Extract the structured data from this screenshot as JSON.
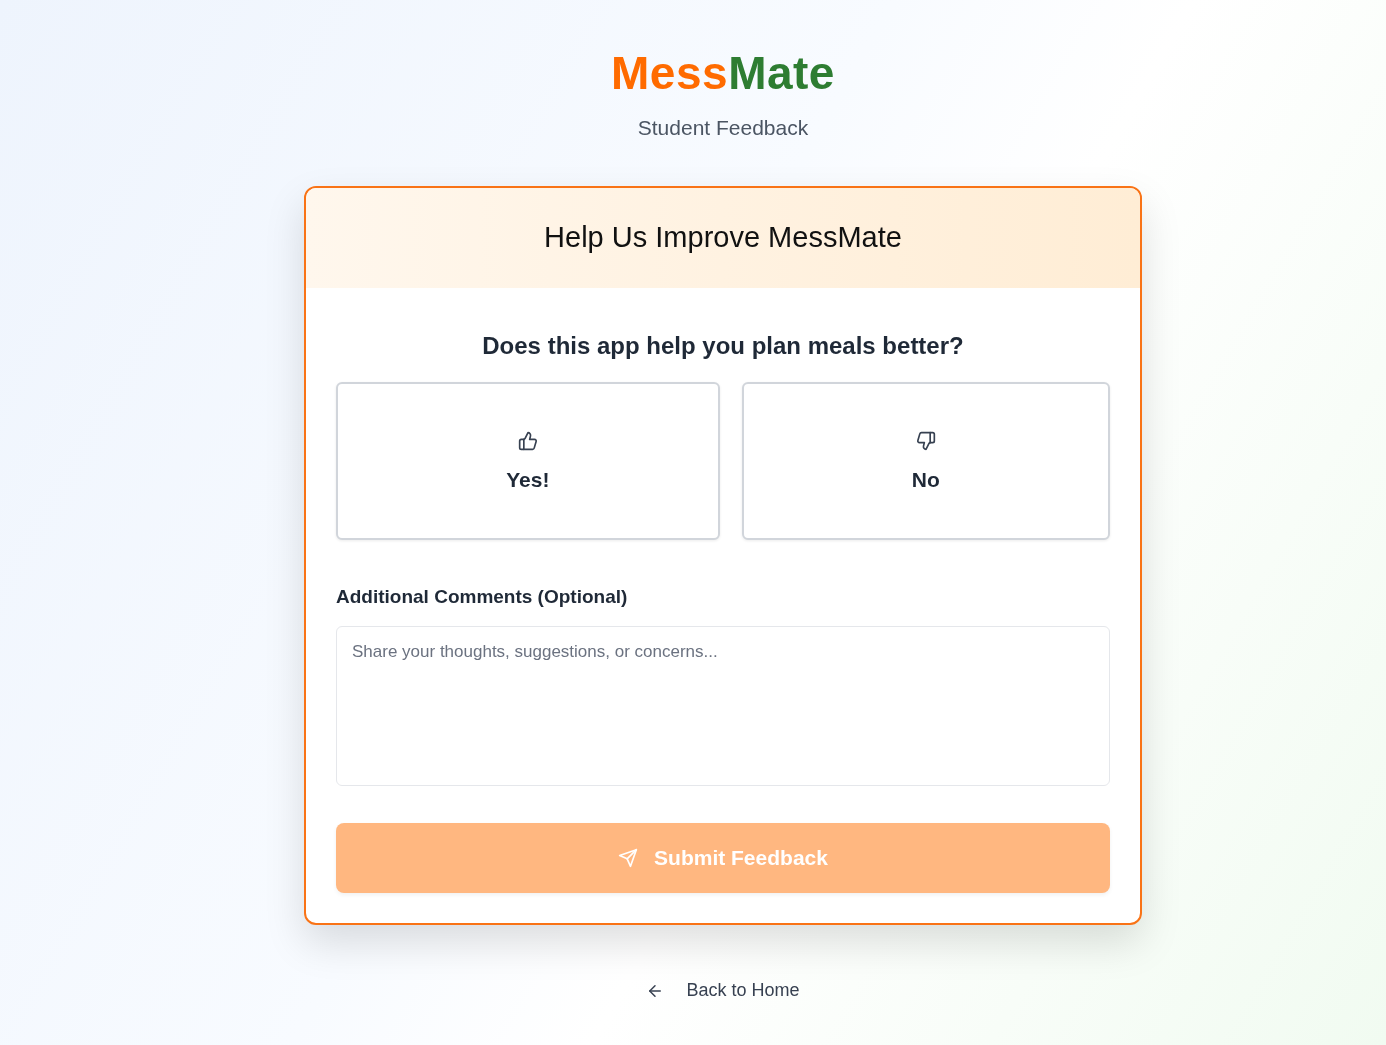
{
  "brand": {
    "parts": [
      {
        "text": "Mess",
        "color": "#ff6b00"
      },
      {
        "text": "Mate",
        "color": "#2e7d32"
      }
    ]
  },
  "subtitle": "Student Feedback",
  "card": {
    "title": "Help Us Improve MessMate",
    "question": "Does this app help you plan meals better?",
    "options": [
      {
        "kind": "thumbs-up",
        "label": "Yes!",
        "selected": false
      },
      {
        "kind": "thumbs-down",
        "label": "No",
        "selected": false
      }
    ],
    "comments": {
      "label": "Additional Comments (Optional)",
      "placeholder": "Share your thoughts, suggestions, or concerns..."
    },
    "submit": {
      "label": "Submit Feedback",
      "disabled": true
    }
  },
  "back_link": {
    "label": "Back to Home"
  }
}
